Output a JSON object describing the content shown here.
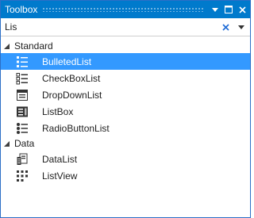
{
  "window": {
    "title": "Toolbox"
  },
  "search": {
    "value": "Lis"
  },
  "groups": [
    {
      "label": "Standard",
      "items": [
        {
          "label": "BulletedList",
          "icon": "bulleted-list-icon",
          "selected": true
        },
        {
          "label": "CheckBoxList",
          "icon": "checkbox-list-icon",
          "selected": false
        },
        {
          "label": "DropDownList",
          "icon": "dropdown-list-icon",
          "selected": false
        },
        {
          "label": "ListBox",
          "icon": "listbox-icon",
          "selected": false
        },
        {
          "label": "RadioButtonList",
          "icon": "radio-button-list-icon",
          "selected": false
        }
      ]
    },
    {
      "label": "Data",
      "items": [
        {
          "label": "DataList",
          "icon": "datalist-icon",
          "selected": false
        },
        {
          "label": "ListView",
          "icon": "listview-icon",
          "selected": false
        }
      ]
    }
  ],
  "colors": {
    "title_bar": "#007acc",
    "selection": "#3399ff",
    "clear_icon": "#1e6bd6"
  }
}
